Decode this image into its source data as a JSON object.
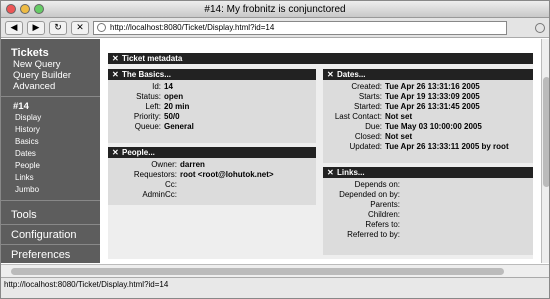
{
  "window": {
    "title": "#14: My frobnitz is conjunctored"
  },
  "toolbar": {
    "url": "http://localhost:8080/Ticket/Display.html?id=14"
  },
  "sidebar": {
    "heading": "Tickets",
    "links": [
      "New Query",
      "Query Builder",
      "Advanced"
    ],
    "ticket_id": "#14",
    "sub_links": [
      "Display",
      "History",
      "Basics",
      "Dates",
      "People",
      "Links",
      "Jumbo"
    ],
    "sections": [
      "Tools",
      "Configuration",
      "Preferences"
    ]
  },
  "content": {
    "metadata_title": "Ticket metadata",
    "basics": {
      "title": "The Basics...",
      "rows": [
        {
          "k": "Id:",
          "v": "14"
        },
        {
          "k": "Status:",
          "v": "open"
        },
        {
          "k": "Left:",
          "v": "20 min"
        },
        {
          "k": "Priority:",
          "v": "50/0"
        },
        {
          "k": "Queue:",
          "v": "General"
        }
      ]
    },
    "people": {
      "title": "People...",
      "rows": [
        {
          "k": "Owner:",
          "v": "darren"
        },
        {
          "k": "Requestors:",
          "v": "root <root@lohutok.net>"
        },
        {
          "k": "Cc:",
          "v": ""
        },
        {
          "k": "AdminCc:",
          "v": ""
        }
      ]
    },
    "dates": {
      "title": "Dates...",
      "rows": [
        {
          "k": "Created:",
          "v": "Tue Apr 26 13:31:16 2005"
        },
        {
          "k": "Starts:",
          "v": "Tue Apr 19 13:33:09 2005"
        },
        {
          "k": "Started:",
          "v": "Tue Apr 26 13:31:45 2005"
        },
        {
          "k": "Last Contact:",
          "v": "Not set"
        },
        {
          "k": "Due:",
          "v": "Tue May 03 10:00:00 2005"
        },
        {
          "k": "Closed:",
          "v": "Not set"
        },
        {
          "k": "Updated:",
          "v": "Tue Apr 26 13:33:11 2005 by root"
        }
      ]
    },
    "links": {
      "title": "Links...",
      "rows": [
        {
          "k": "Depends on:",
          "v": ""
        },
        {
          "k": "Depended on by:",
          "v": ""
        },
        {
          "k": "Parents:",
          "v": ""
        },
        {
          "k": "Children:",
          "v": ""
        },
        {
          "k": "Refers to:",
          "v": ""
        },
        {
          "k": "Referred to by:",
          "v": ""
        }
      ]
    }
  },
  "status": {
    "text": "http://localhost:8080/Ticket/Display.html?id=14"
  }
}
